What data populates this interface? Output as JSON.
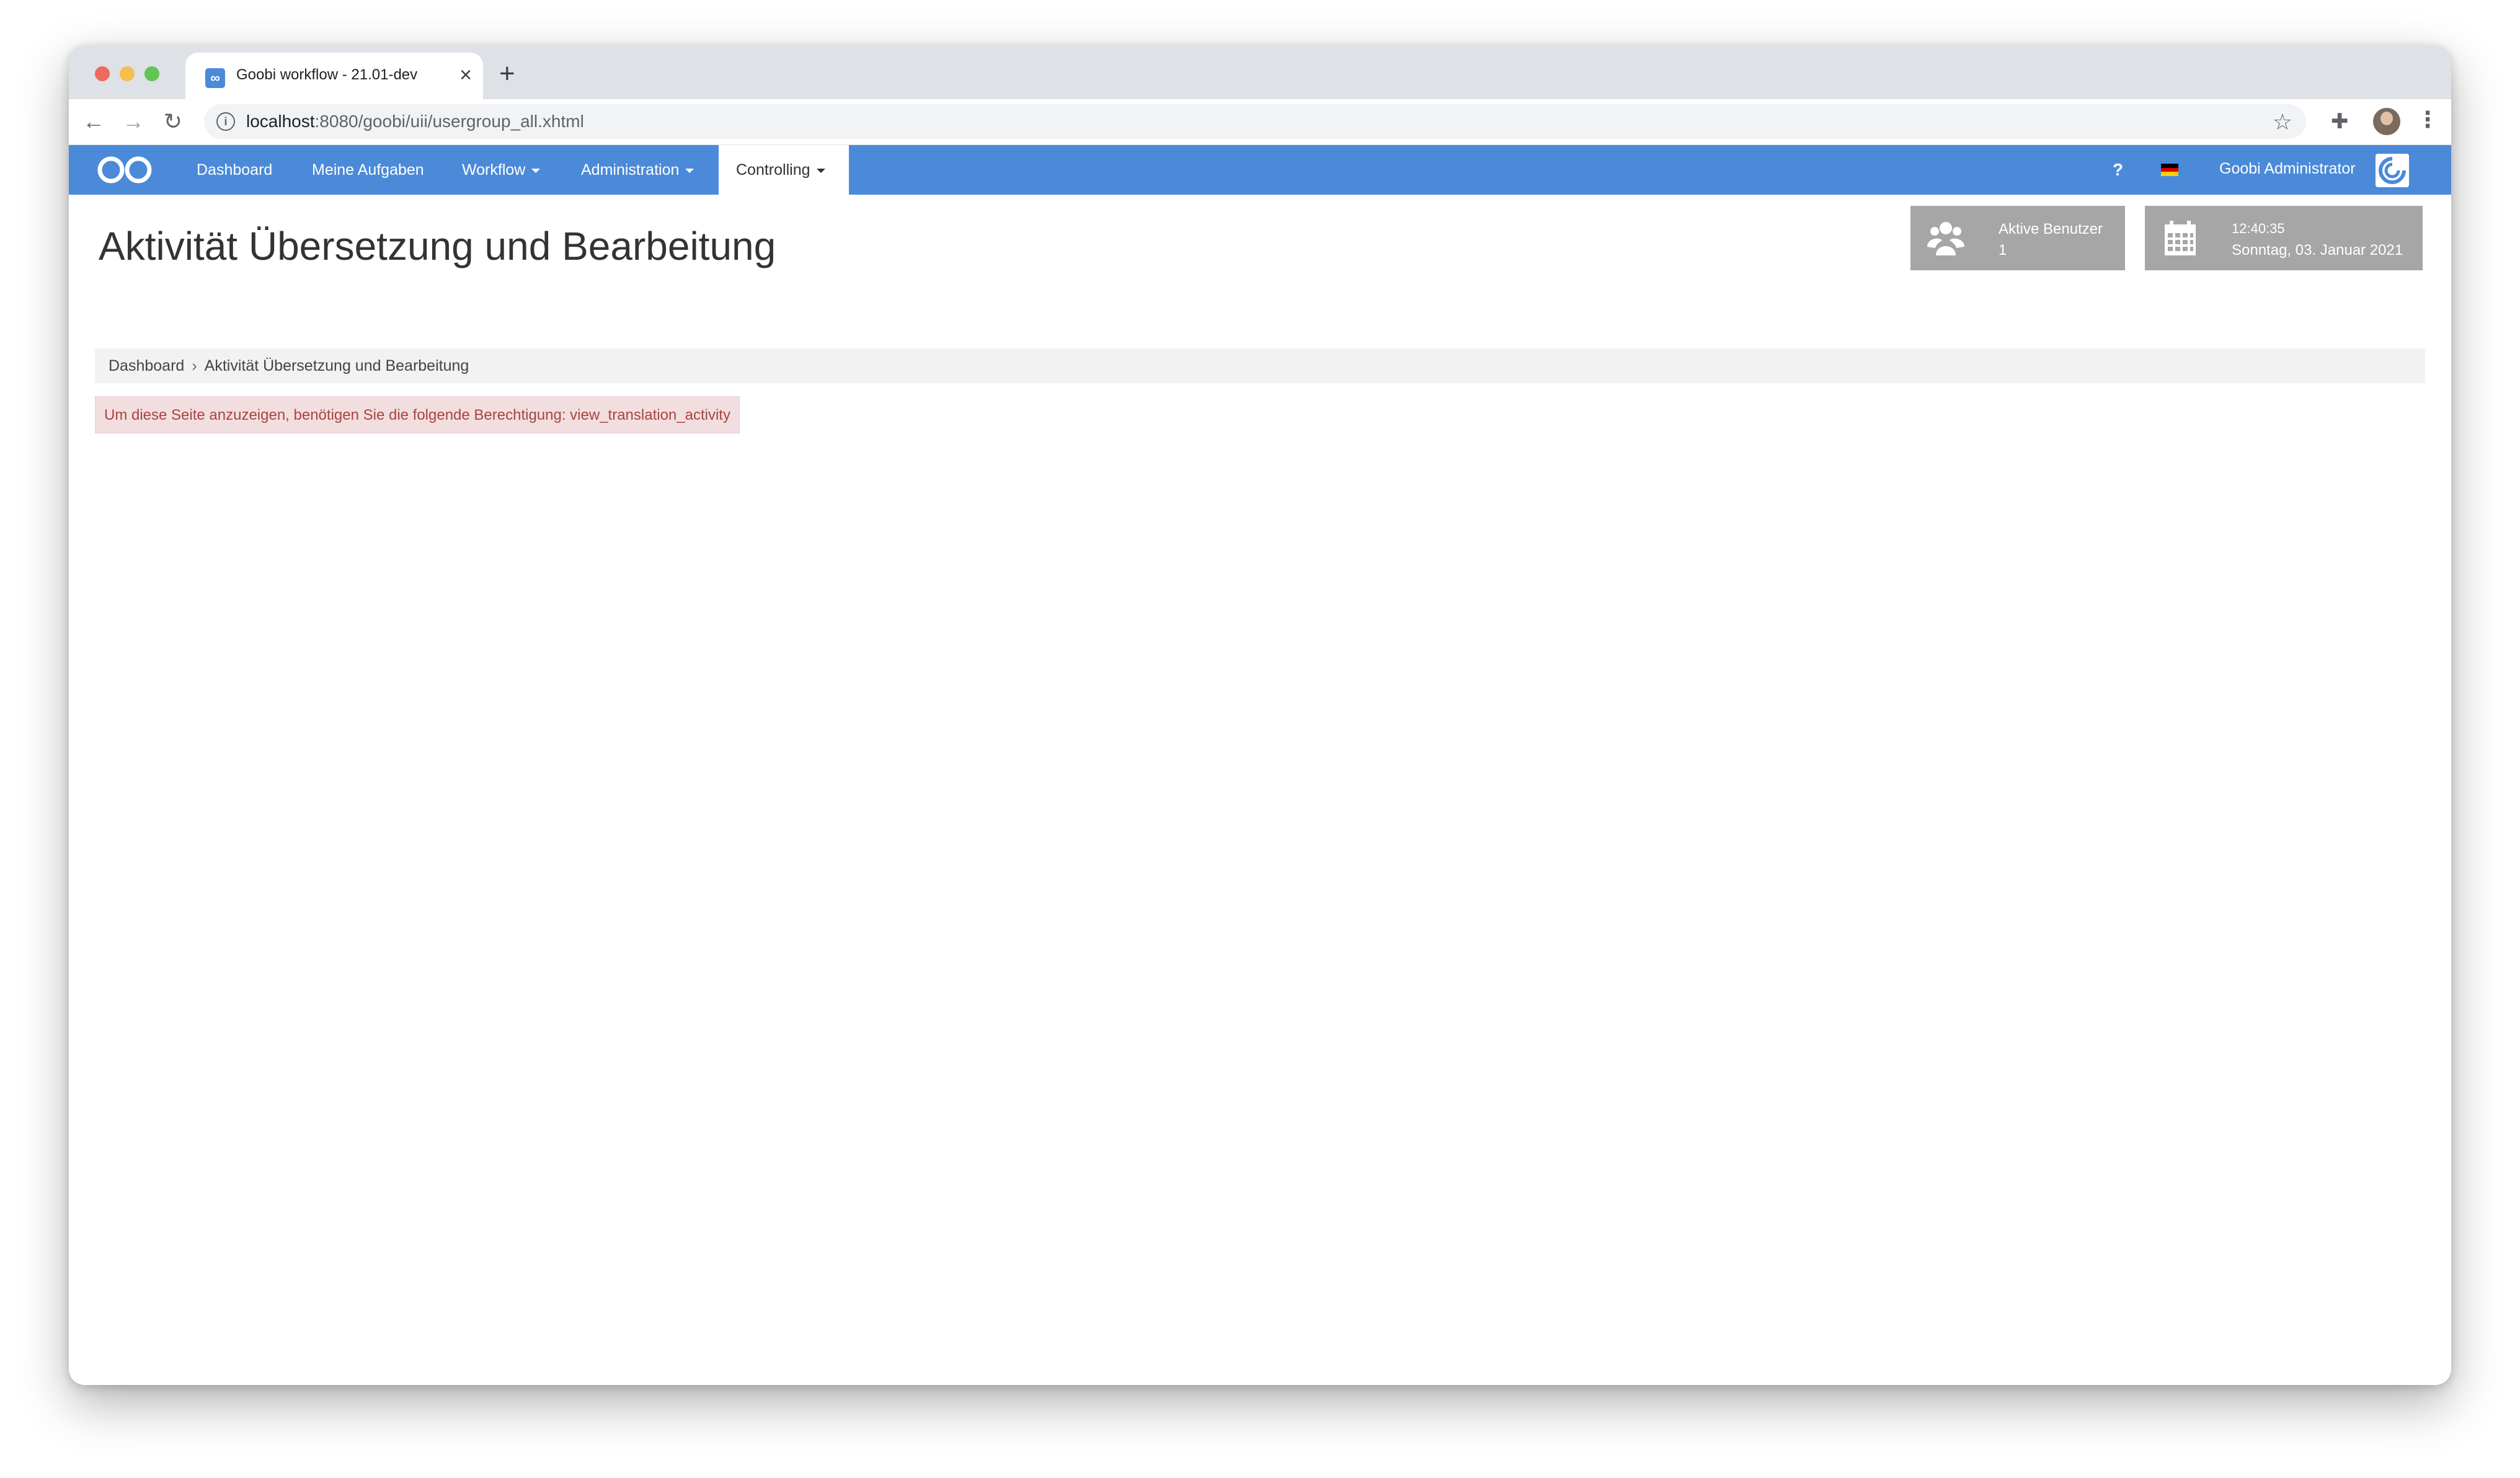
{
  "browser": {
    "tab_title": "Goobi workflow - 21.01-dev",
    "tab_favicon": "∞",
    "url_host": "localhost",
    "url_rest": ":8080/goobi/uii/usergroup_all.xhtml",
    "icons": {
      "back": "back-arrow-icon",
      "forward": "forward-arrow-icon",
      "reload": "reload-icon",
      "info": "info-icon",
      "star": "bookmark-star-icon",
      "extensions": "puzzle-icon",
      "menu": "kebab-menu-icon"
    }
  },
  "navbar": {
    "brand_color": "#4a8ad9",
    "items": [
      {
        "label": "Dashboard",
        "dropdown": false
      },
      {
        "label": "Meine Aufgaben",
        "dropdown": false
      },
      {
        "label": "Workflow",
        "dropdown": true
      },
      {
        "label": "Administration",
        "dropdown": true
      },
      {
        "label": "Controlling",
        "dropdown": true,
        "active": true
      }
    ],
    "help": "?",
    "language_flag": "german-flag-icon",
    "user": "Goobi Administrator"
  },
  "page": {
    "title": "Aktivität Übersetzung und Bearbeitung"
  },
  "widgets": {
    "users": {
      "label": "Aktive Benutzer",
      "value": "1",
      "icon": "users-icon"
    },
    "clock": {
      "time": "12:40:35",
      "date": "Sonntag, 03. Januar 2021",
      "icon": "calendar-icon"
    }
  },
  "breadcrumb": {
    "home": "Dashboard",
    "separator": "›",
    "current": "Aktivität Übersetzung und Bearbeitung"
  },
  "alert": {
    "message": "Um diese Seite anzuzeigen, benötigen Sie die folgende Berechtigung: view_translation_activity",
    "color": "#a94442"
  }
}
